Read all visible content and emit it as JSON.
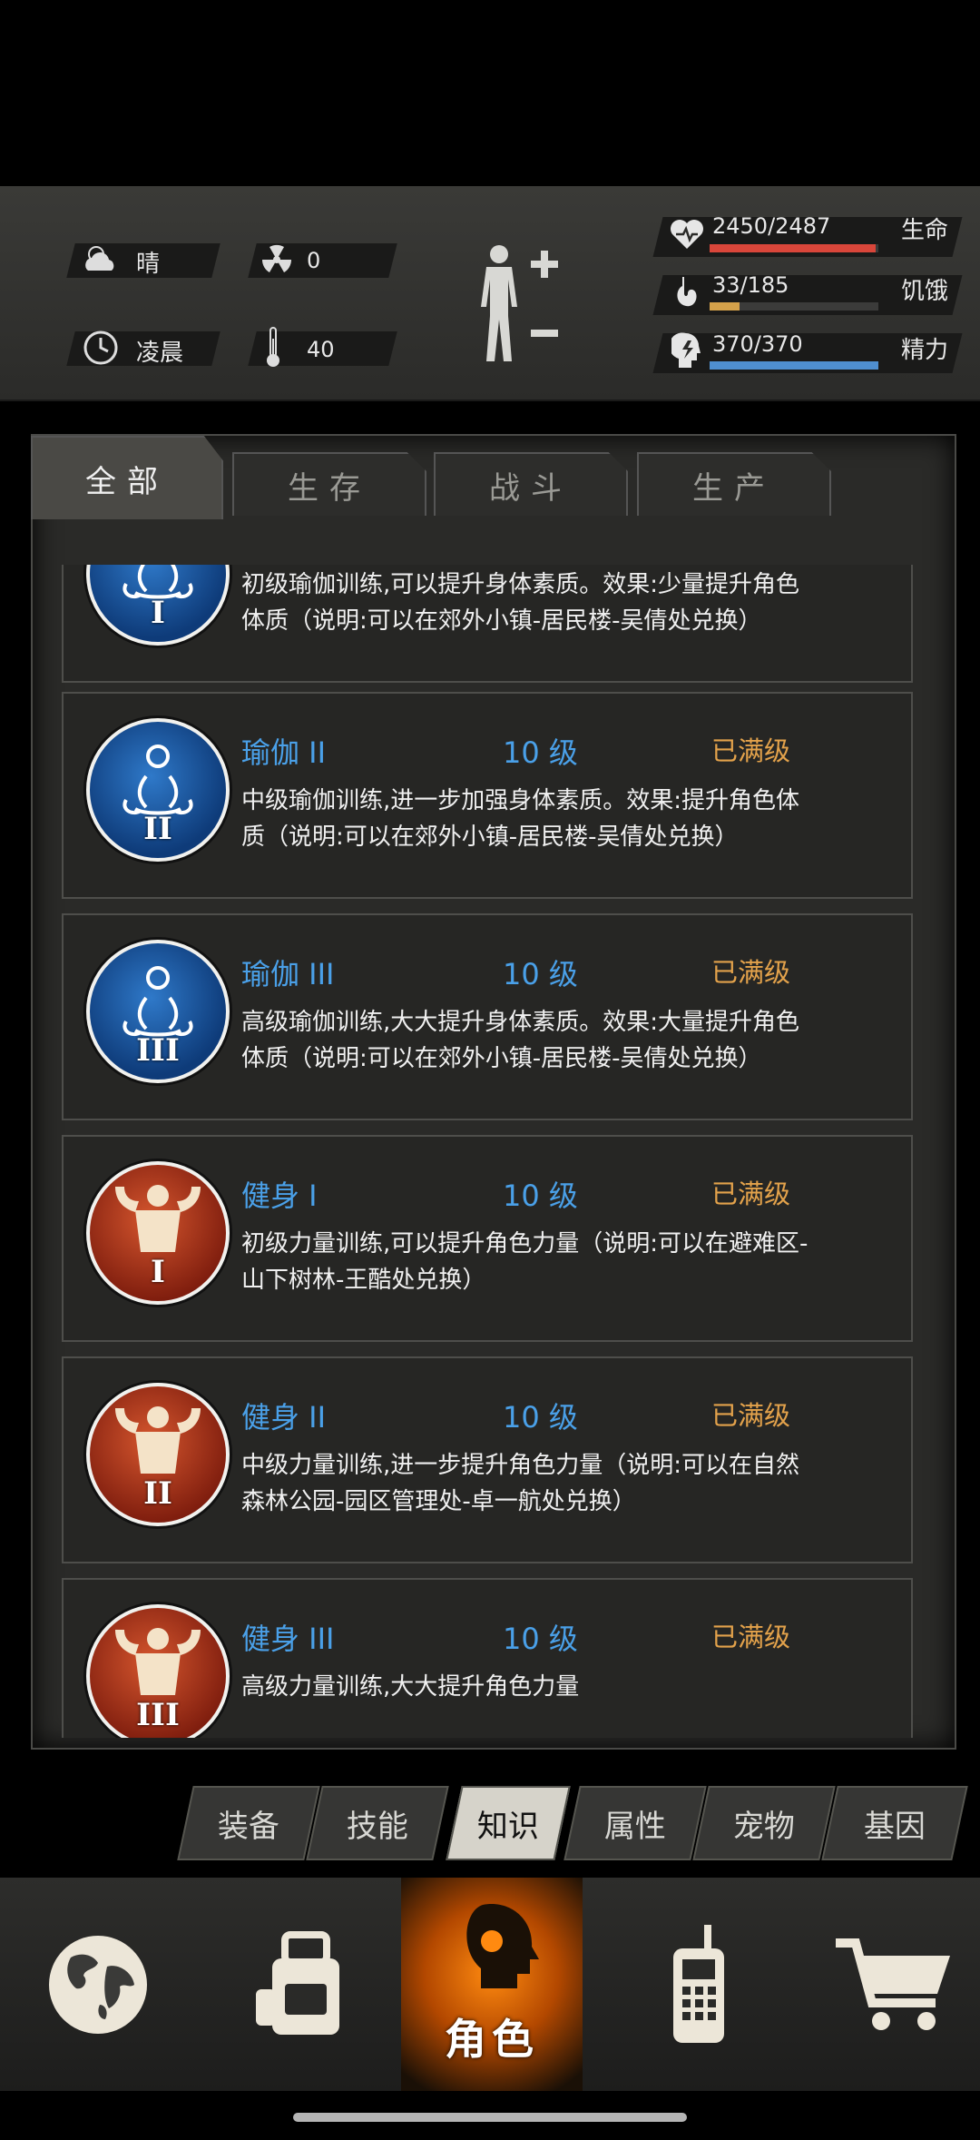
{
  "hud": {
    "weather": "晴",
    "radiation": "0",
    "time_of_day": "凌晨",
    "temperature": "40",
    "health": {
      "value": "2450/2487",
      "label": "生命",
      "fraction": 0.985,
      "color": "#d9463a"
    },
    "hunger": {
      "value": "33/185",
      "label": "饥饿",
      "fraction": 0.178,
      "color": "#d4a14a"
    },
    "energy": {
      "value": "370/370",
      "label": "精力",
      "fraction": 1.0,
      "color": "#4f8fd0"
    }
  },
  "tabs": [
    {
      "label": "全部",
      "active": true
    },
    {
      "label": "生存",
      "active": false
    },
    {
      "label": "战斗",
      "active": false
    },
    {
      "label": "生产",
      "active": false
    }
  ],
  "skills": [
    {
      "name": "",
      "level": "",
      "status": "",
      "icon": "yoga-icon",
      "roman": "I",
      "theme": "blue",
      "desc": "初级瑜伽训练,可以提升身体素质。效果:少量提升角色体质（说明:可以在郊外小镇-居民楼-吴倩处兑换）"
    },
    {
      "name": "瑜伽 II",
      "level": "10 级",
      "status": "已满级",
      "icon": "yoga-icon",
      "roman": "II",
      "theme": "blue",
      "desc": "中级瑜伽训练,进一步加强身体素质。效果:提升角色体质（说明:可以在郊外小镇-居民楼-吴倩处兑换）"
    },
    {
      "name": "瑜伽 III",
      "level": "10 级",
      "status": "已满级",
      "icon": "yoga-icon",
      "roman": "III",
      "theme": "blue",
      "desc": "高级瑜伽训练,大大提升身体素质。效果:大量提升角色体质（说明:可以在郊外小镇-居民楼-吴倩处兑换）"
    },
    {
      "name": "健身 I",
      "level": "10 级",
      "status": "已满级",
      "icon": "muscle-icon",
      "roman": "I",
      "theme": "red",
      "desc": "初级力量训练,可以提升角色力量（说明:可以在避难区-山下树林-王酷处兑换）"
    },
    {
      "name": "健身 II",
      "level": "10 级",
      "status": "已满级",
      "icon": "muscle-icon",
      "roman": "II",
      "theme": "red",
      "desc": "中级力量训练,进一步提升角色力量（说明:可以在自然森林公园-园区管理处-卓一航处兑换）"
    },
    {
      "name": "健身 III",
      "level": "10 级",
      "status": "已满级",
      "icon": "muscle-icon",
      "roman": "III",
      "theme": "red",
      "desc": "高级力量训练,大大提升角色力量"
    }
  ],
  "subtabs": [
    {
      "label": "装备",
      "active": false
    },
    {
      "label": "技能",
      "active": false
    },
    {
      "label": "知识",
      "active": true
    },
    {
      "label": "属性",
      "active": false
    },
    {
      "label": "宠物",
      "active": false
    },
    {
      "label": "基因",
      "active": false
    }
  ],
  "nav": {
    "active_label": "角色"
  }
}
